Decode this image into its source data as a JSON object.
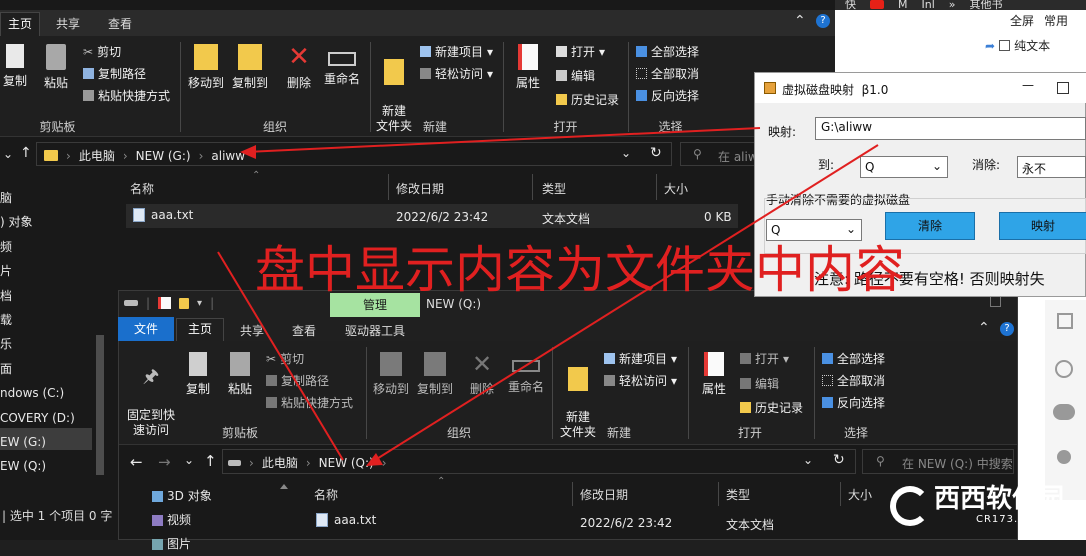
{
  "browser_bar": {
    "items": [
      "快",
      "M",
      "Inl",
      "»",
      "其他书"
    ]
  },
  "right_panel": {
    "label_a": "全屏",
    "label_b": "常用",
    "checkbox_label": "纯文本"
  },
  "win1": {
    "tabs": [
      "主页",
      "共享",
      "查看"
    ],
    "ribbon": {
      "copy": "复制",
      "paste": "粘贴",
      "cut": "剪切",
      "copy_path": "复制路径",
      "paste_shortcut": "粘贴快捷方式",
      "move_to": "移动到",
      "copy_to": "复制到",
      "delete": "删除",
      "rename": "重命名",
      "new_folder": "新建\n文件夹",
      "new_item": "新建项目",
      "easy_access": "轻松访问",
      "properties": "属性",
      "open": "打开",
      "edit": "编辑",
      "history": "历史记录",
      "select_all": "全部选择",
      "select_none": "全部取消",
      "invert_selection": "反向选择",
      "groups": [
        "剪贴板",
        "组织",
        "新建",
        "打开",
        "选择"
      ]
    },
    "address": {
      "crumbs": [
        "此电脑",
        "NEW (G:)",
        "aliww"
      ],
      "search_placeholder": "在 aliw"
    },
    "columns": [
      "名称",
      "修改日期",
      "类型",
      "大小"
    ],
    "file": {
      "name": "aaa.txt",
      "date": "2022/6/2 23:42",
      "type": "文本文档",
      "size": "0 KB"
    },
    "sidebar": [
      "脑",
      ") 对象",
      "频",
      "片",
      "档",
      "载",
      "乐",
      "面",
      "ndows (C:)",
      "COVERY (D:)",
      "EW (G:)",
      "EW (Q:)"
    ],
    "status": "| 选中 1 个项目 0 字"
  },
  "dialog": {
    "title": "虚拟磁盘映射  β1.0",
    "map_label": "映射:",
    "map_value": "G:\\aliww",
    "to_label": "到:",
    "to_value": "Q",
    "cancel_label": "消除:",
    "cancel_value": "永不",
    "section_label": "手动清除不需要的虚拟磁盘",
    "drive_value": "Q",
    "clear_button": "清除",
    "map_button": "映射",
    "note": "注意: 路径不要有空格! 否则映射失"
  },
  "annotation": {
    "text": "盘中显示内容为文件夹中内容",
    "color": "#e02020"
  },
  "win2": {
    "title": "NEW (Q:)",
    "context_tab": "管理",
    "tabs": [
      "文件",
      "主页",
      "共享",
      "查看",
      "驱动器工具"
    ],
    "ribbon": {
      "pin": "固定到快\n速访问",
      "copy": "复制",
      "paste": "粘贴",
      "cut": "剪切",
      "copy_path": "复制路径",
      "paste_shortcut": "粘贴快捷方式",
      "move_to": "移动到",
      "copy_to": "复制到",
      "delete": "删除",
      "rename": "重命名",
      "new_folder": "新建\n文件夹",
      "new_item": "新建项目",
      "easy_access": "轻松访问",
      "properties": "属性",
      "open": "打开",
      "edit": "编辑",
      "history": "历史记录",
      "select_all": "全部选择",
      "select_none": "全部取消",
      "invert_selection": "反向选择",
      "groups": [
        "剪贴板",
        "组织",
        "新建",
        "打开",
        "选择"
      ]
    },
    "address": {
      "crumbs": [
        "此电脑",
        "NEW (Q:)"
      ],
      "search_placeholder": "在 NEW (Q:) 中搜索"
    },
    "columns": [
      "名称",
      "修改日期",
      "类型",
      "大小"
    ],
    "file": {
      "name": "aaa.txt",
      "date": "2022/6/2 23:42",
      "type": "文本文档"
    },
    "sidebar": [
      "3D 对象",
      "视频",
      "图片"
    ]
  },
  "watermark": {
    "brand": "西西软件园",
    "url": "CR173.COM"
  }
}
